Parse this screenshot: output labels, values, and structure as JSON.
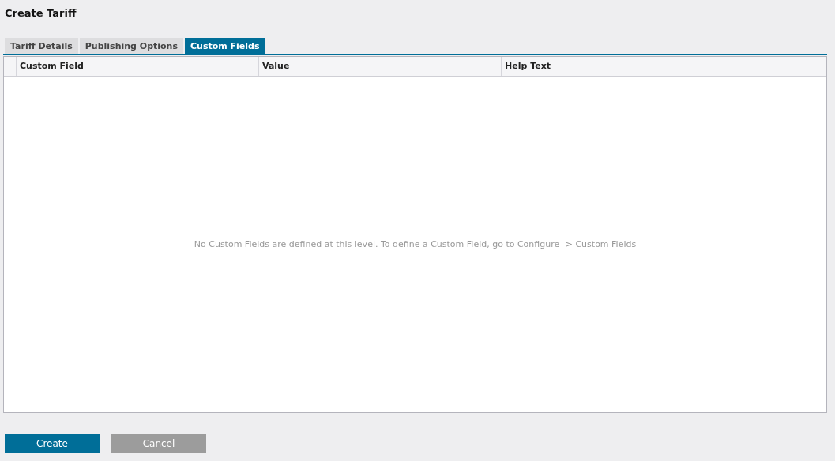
{
  "title": "Create Tariff",
  "tabs": [
    {
      "label": "Tariff Details",
      "selected": false
    },
    {
      "label": "Publishing Options",
      "selected": false
    },
    {
      "label": "Custom Fields",
      "selected": true
    }
  ],
  "table": {
    "columns": [
      "Custom Field",
      "Value",
      "Help Text"
    ],
    "empty_message": "No Custom Fields are defined at this level. To define a Custom Field, go to Configure -> Custom Fields"
  },
  "buttons": [
    {
      "label": "Create",
      "kind": "primary"
    },
    {
      "label": "Cancel",
      "kind": "secondary"
    }
  ]
}
